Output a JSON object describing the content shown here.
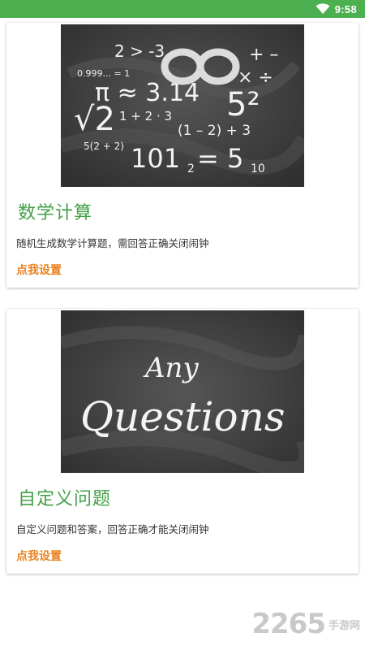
{
  "status_bar": {
    "time": "9:58",
    "icon": "wifi-icon",
    "color": "#4caf50"
  },
  "cards": [
    {
      "image_icon": "math-chalkboard-image",
      "image_text": {
        "line1": "2 > -3",
        "line2": "0.999... = 1",
        "pi": "π ≈ 3.14",
        "sqrt": "√2",
        "sum": "1 + 2 · 3",
        "sq": "5²",
        "neg": "(1 – 2) + 3",
        "mul": "5(2 + 2)",
        "base": "101",
        "base_sub": "2",
        "eq": "= 5",
        "eq_sub": "10",
        "ops": "+ –",
        "ops2": "× ÷"
      },
      "title": "数学计算",
      "description": "随机生成数学计算题，需回答正确关闭闹钟",
      "action": "点我设置"
    },
    {
      "image_icon": "questions-chalkboard-image",
      "image_text": {
        "line1": "Any",
        "line2": "Questions"
      },
      "title": "自定义问题",
      "description": "自定义问题和答案，回答正确才能关闭闹钟",
      "action": "点我设置"
    }
  ],
  "watermark": {
    "number": "2265",
    "text": "手游网"
  },
  "colors": {
    "accent_green": "#43a047",
    "action_orange": "#e8821e"
  }
}
